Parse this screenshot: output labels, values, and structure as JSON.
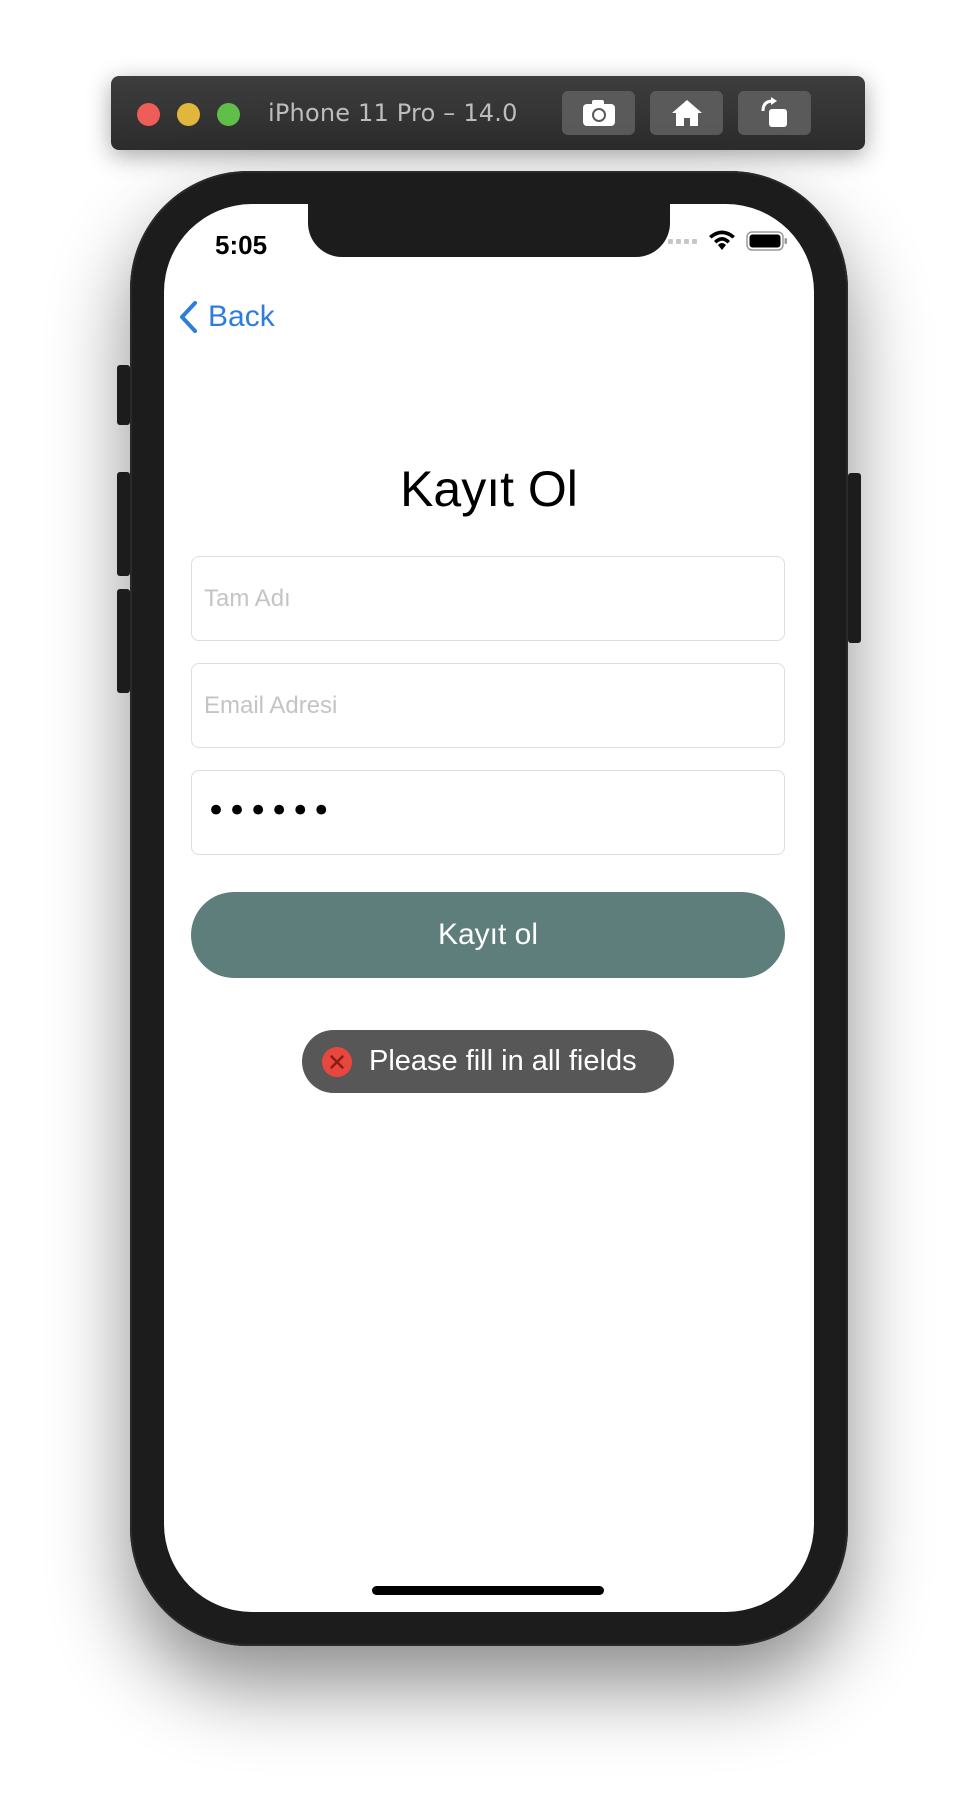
{
  "simulator": {
    "title": "iPhone 11 Pro – 14.0",
    "buttons": [
      "screenshot-icon",
      "home-icon",
      "rotate-icon"
    ]
  },
  "status_bar": {
    "time": "5:05",
    "icons": [
      "signal-icon",
      "wifi-icon",
      "battery-icon"
    ]
  },
  "nav": {
    "back_label": "Back"
  },
  "form": {
    "title": "Kayıt Ol",
    "full_name_placeholder": "Tam Adı",
    "email_placeholder": "Email Adresi",
    "password_value": "••••••",
    "submit_label": "Kayıt ol"
  },
  "toast": {
    "message": "Please fill in all fields",
    "icon": "error-icon"
  },
  "colors": {
    "accent": "#2f7ddb",
    "button": "#5e7e7c",
    "toast_bg": "#575757",
    "error": "#e8473f"
  }
}
